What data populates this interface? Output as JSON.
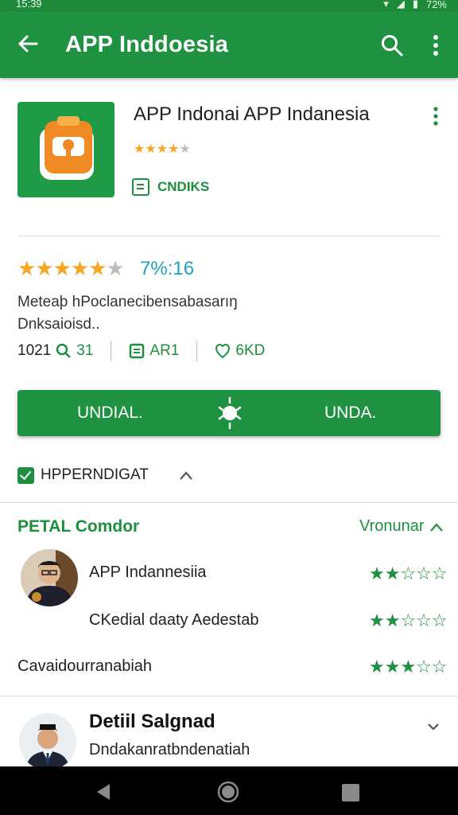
{
  "status_bar": {
    "time": "15:39",
    "battery": "72%"
  },
  "app_bar": {
    "title": "APP Inddoesia",
    "icons": [
      "back-arrow-icon",
      "search-icon",
      "more-vert-icon"
    ]
  },
  "app_header": {
    "name": "APP Indonai APP Indanesia",
    "small_rating": 4,
    "developer_label": "CNDIKS",
    "developer_icon": "document-icon"
  },
  "rating": {
    "stars": 5,
    "text": "7%:16",
    "description_line1": "Meteaþ hPoclanecibensabasarıŋ",
    "description_line2": "Dnksaioisd.."
  },
  "meta": {
    "count": "1021",
    "downloads": "31",
    "size_label": "AR1",
    "age_label": "6KD"
  },
  "install_bar": {
    "left_label": "UNDIAL.",
    "right_label": "UNDA."
  },
  "checkbox": {
    "label": "HPPERNDIGAT",
    "checked": true
  },
  "reviews": {
    "section_title": "PETAL Comdor",
    "section_action": "Vronunar",
    "items": [
      {
        "text": "APP Indannesiia",
        "stars": "★★☆☆☆"
      },
      {
        "text": "CKedial daaty Aedestab",
        "stars": "★★☆☆☆"
      },
      {
        "text": "Cavaidourranabiah",
        "stars": "★★★☆☆"
      }
    ]
  },
  "detail": {
    "title": "Detiil Salgnad",
    "subtitle": "Dndakanratbndenatiah"
  },
  "colors": {
    "primary_green": "#1e9241",
    "accent_teal": "#1fa0bf",
    "star_gold": "#f5a623"
  }
}
